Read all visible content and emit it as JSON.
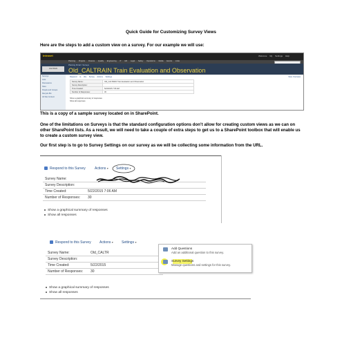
{
  "doc": {
    "title": "Quick Guide for Customizing Survey Views",
    "intro": "Here are the steps to add a custom view on a survey. For our example we will use:",
    "copy_note": "This is a copy of a sample survey located on in SharePoint.",
    "limitations": "One of the limitations on Surveys is that the standard configuration options don’t allow for creating custom views as we can on other SharePoint lists.  As a result, we will need to take a couple of extra steps to get us to a SharePoint toolbox that will enable us to create a custom survey view.",
    "first_step": "Our first step is to go to Survey Settings on our survey as we will be collecting some information from the URL."
  },
  "shot1": {
    "logo": "Intranet",
    "tools": "Welcome  My Settings  Help",
    "nav_items": [
      "Planning",
      "Projects",
      "Finance",
      "Quality",
      "Engineering",
      "IT",
      "HR",
      "Legal",
      "Safety",
      "Operations",
      "Media",
      "Events",
      "Links"
    ],
    "breadcrumb": "Planning Portal > Surveys",
    "badge": "CALTRAIN",
    "title": "Old_CALTRAIN Train Evaluation and Observation",
    "left_items": [
      "Surveys",
      "Lists",
      "Discussions",
      "Sites",
      "People and Groups",
      "Recycle Bin",
      "All Site Content"
    ],
    "actions": "Respond to this Survey  Actions  Settings",
    "view": "View: Overview",
    "rows": [
      {
        "k": "Survey Name:",
        "v": "Old_CALTRAIN Train Evaluation and Observation"
      },
      {
        "k": "Survey Description:",
        "v": ""
      },
      {
        "k": "Time Created:",
        "v": "5/22/2015 7:06 AM"
      },
      {
        "k": "Number of Responses:",
        "v": "30"
      }
    ],
    "links": [
      "Show a graphical summary of responses",
      "Show all responses"
    ]
  },
  "shot2": {
    "respond": "Respond to this Survey",
    "actions": "Actions",
    "settings": "Settings",
    "rows": [
      {
        "k": "Survey Name:",
        "v": ""
      },
      {
        "k": "Survey Description:",
        "v": ""
      },
      {
        "k": "Time Created:",
        "v": "5/22/2015 7:06 AM"
      },
      {
        "k": "Number of Responses:",
        "v": "30"
      }
    ],
    "links": [
      "Show a graphical summary of responses",
      "Show all responses"
    ]
  },
  "shot3": {
    "respond": "Respond to this Survey",
    "actions": "Actions",
    "settings": "Settings",
    "rows": [
      {
        "k": "Survey Name:",
        "v": "Old_CALTR"
      },
      {
        "k": "Survey Description:",
        "v": ""
      },
      {
        "k": "Time Created:",
        "v": "5/22/2015"
      },
      {
        "k": "Number of Responses:",
        "v": "30"
      }
    ],
    "menu": {
      "item1_title": "Add Questions",
      "item1_desc": "Add an additional question to this survey.",
      "item2_title": "Survey Settings",
      "item2_desc": "Manage questions and settings for this survey."
    },
    "links": [
      "Show a graphical summary of responses",
      "Show all responses"
    ]
  },
  "colors": {
    "highlight": "#f2f033",
    "link": "#1f4a85",
    "header": "#2c3d54",
    "title_yellow": "#f0d64a"
  }
}
